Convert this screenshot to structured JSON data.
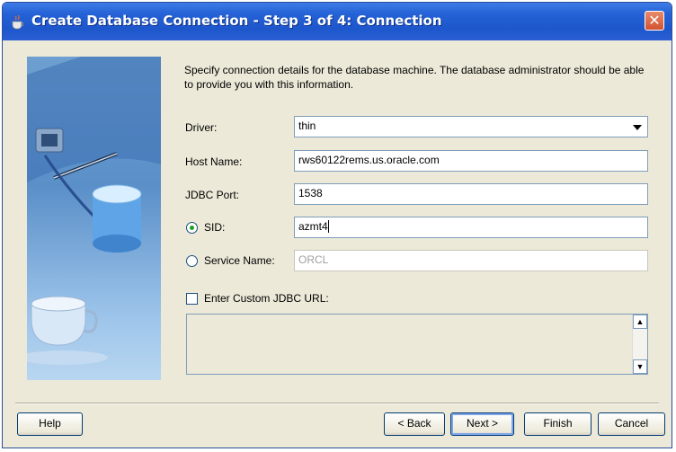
{
  "window": {
    "title": "Create Database Connection - Step 3 of 4: Connection"
  },
  "description": "Specify connection details for the database machine. The database administrator should be able to provide you with this information.",
  "form": {
    "driver": {
      "label": "Driver:",
      "value": "thin"
    },
    "host": {
      "label": "Host Name:",
      "value": "rws60122rems.us.oracle.com"
    },
    "port": {
      "label": "JDBC Port:",
      "value": "1538"
    },
    "sid": {
      "label": "SID:",
      "value": "azmt4",
      "selected": true
    },
    "service": {
      "label": "Service Name:",
      "value": "ORCL",
      "selected": false
    },
    "custom_url": {
      "label": "Enter Custom JDBC URL:",
      "checked": false,
      "value": ""
    }
  },
  "buttons": {
    "help": "Help",
    "back": "< Back",
    "next": "Next >",
    "finish": "Finish",
    "cancel": "Cancel"
  },
  "icons": {
    "title": "coffee-cup-icon",
    "close": "close-icon"
  },
  "colors": {
    "titlebar": "#2462d6",
    "dialog_bg": "#ece9d8",
    "close": "#d2522f",
    "radio_selected": "#21a121"
  }
}
